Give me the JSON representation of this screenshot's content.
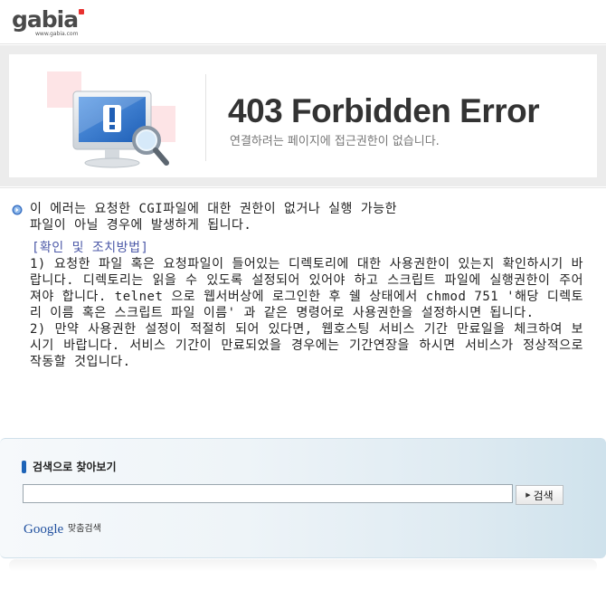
{
  "header": {
    "logo_text": "gabia",
    "logo_url": "www.gabia.com",
    "logo_dot_color": "#e8312f"
  },
  "banner": {
    "title": "403 Forbidden Error",
    "subtitle": "연결하려는 페이지에 접근권한이 없습니다.",
    "illustration_icon": "monitor-warning-magnifier-icon"
  },
  "content": {
    "description": "이 에러는 요청한 CGI파일에 대한 권한이 없거나 실행 가능한\n파일이 아닐 경우에 발생하게 됩니다.",
    "guide_heading": "[확인 및 조치방법]",
    "guide_body": "1) 요청한 파일 혹은 요청파일이 들어있는 디렉토리에 대한 사용권한이 있는지 확인하시기 바랍니다. 디렉토리는 읽을 수 있도록 설정되어 있어야 하고 스크립트 파일에 실행권한이 주어져야 합니다. telnet 으로 웹서버상에 로그인한 후 쉘 상태에서 chmod 751 '해당 디렉토리 이름 혹은 스크립트 파일 이름' 과 같은 명령어로 사용권한을 설정하시면 됩니다.\n2) 만약 사용권한 설정이 적절히 되어 있다면, 웹호스팅 서비스 기간 만료일을 체크하여 보시기 바랍니다. 서비스 기간이 만료되었을 경우에는 기간연장을 하시면 서비스가 정상적으로 작동할 것입니다.",
    "accent_color": "#4d5aa8"
  },
  "search": {
    "title": "검색으로 찾아보기",
    "input_value": "",
    "button_label": "검색",
    "google_label": "Google",
    "google_sub": "맞춤검색"
  }
}
